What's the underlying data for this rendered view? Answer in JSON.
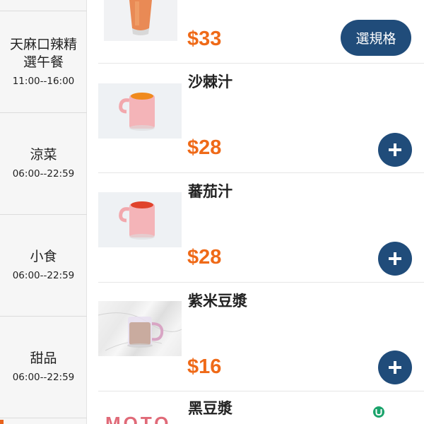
{
  "sidebar": {
    "categories": [
      {
        "name": "天麻口辣精選午餐",
        "hours": "11:00--16:00"
      },
      {
        "name": "涼菜",
        "hours": "06:00--22:59"
      },
      {
        "name": "小食",
        "hours": "06:00--22:59"
      },
      {
        "name": "甜品",
        "hours": "06:00--22:59"
      }
    ]
  },
  "products": [
    {
      "name": "",
      "price": "$33",
      "action_label": "選規格",
      "image": "orange-iced-drink-photo"
    },
    {
      "name": "沙棘汁",
      "price": "$28",
      "action_label": "+",
      "image": "sea-buckthorn-juice-mug-photo"
    },
    {
      "name": "蕃茄汁",
      "price": "$28",
      "action_label": "+",
      "image": "tomato-juice-mug-photo"
    },
    {
      "name": "紫米豆漿",
      "price": "$16",
      "action_label": "+",
      "image": "purple-rice-soy-milk-glass-photo"
    },
    {
      "name": "黑豆漿",
      "price": "",
      "action_label": "",
      "image": "moto-brand-photo",
      "image_text": "MOTO"
    }
  ],
  "colors": {
    "price": "#ef6a18",
    "button": "#204c7a",
    "sidebar_bg": "#f6f6f6",
    "indicator": "#e8631c"
  },
  "icons": {
    "add": "plus-icon",
    "badge": "u-badge-icon"
  }
}
